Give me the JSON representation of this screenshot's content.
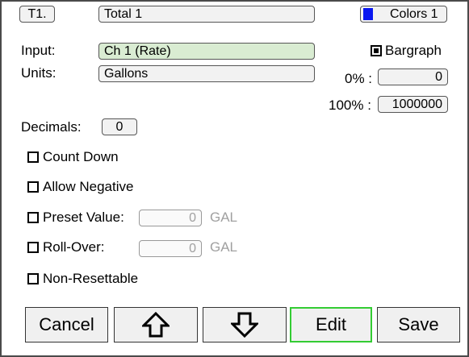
{
  "totalizer": {
    "id_label": "T1.",
    "name": "Total 1",
    "input_label": "Input:",
    "input_value": "Ch 1 (Rate)",
    "units_label": "Units:",
    "units_value": "Gallons",
    "decimals_label": "Decimals:",
    "decimals_value": "0"
  },
  "colors": {
    "label": "Colors 1",
    "swatch_color": "#0a18f0"
  },
  "bargraph": {
    "label": "Bargraph",
    "checked": true,
    "zero_label": "0% :",
    "zero_value": "0",
    "full_label": "100% :",
    "full_value": "1000000"
  },
  "options": {
    "count_down": {
      "label": "Count Down",
      "checked": false
    },
    "allow_negative": {
      "label": "Allow Negative",
      "checked": false
    },
    "preset": {
      "label": "Preset Value:",
      "checked": false,
      "value": "0",
      "unit": "GAL"
    },
    "rollover": {
      "label": "Roll-Over:",
      "checked": false,
      "value": "0",
      "unit": "GAL"
    },
    "non_resettable": {
      "label": "Non-Resettable",
      "checked": false
    }
  },
  "buttons": {
    "cancel": "Cancel",
    "up_icon": "arrow-up-outline",
    "down_icon": "arrow-down-outline",
    "edit": "Edit",
    "save": "Save"
  }
}
